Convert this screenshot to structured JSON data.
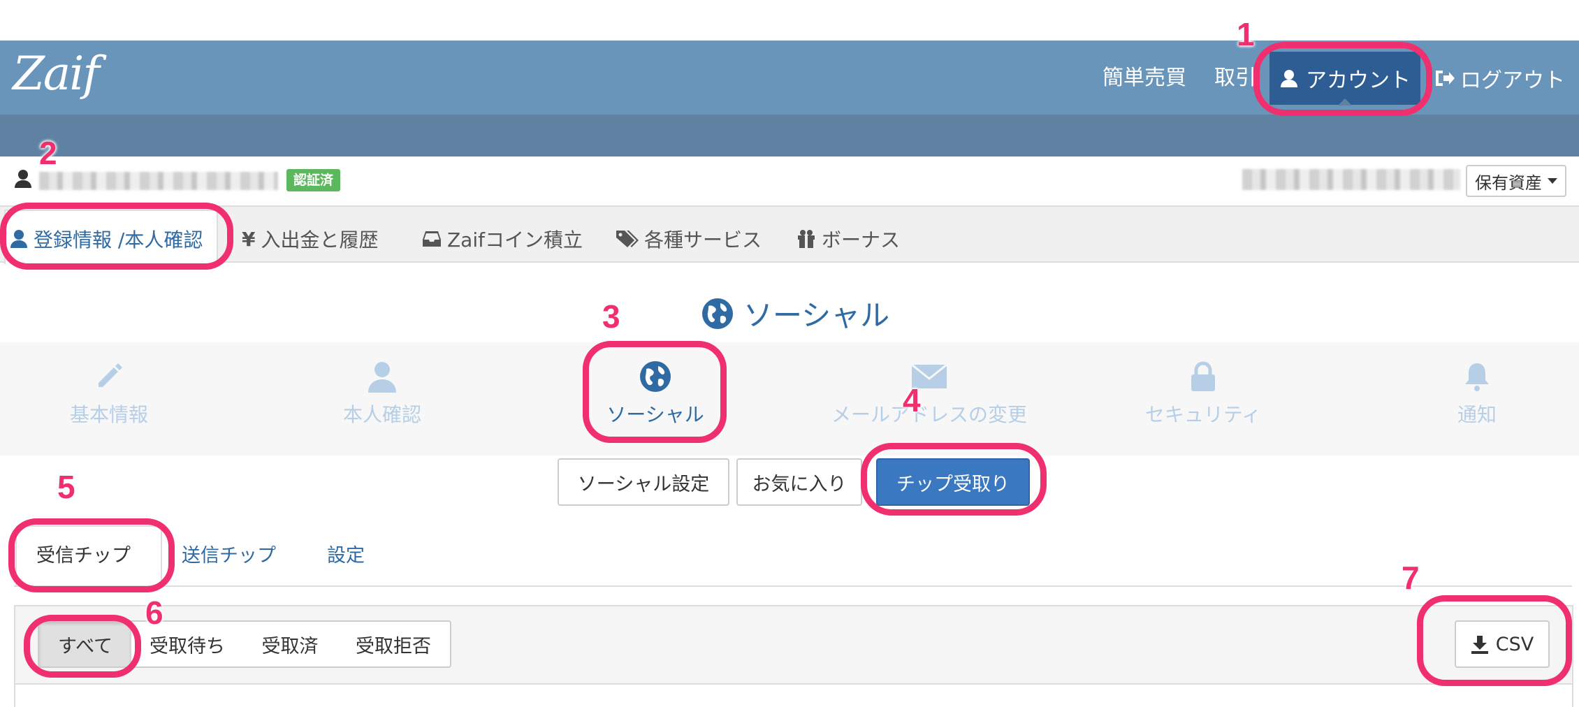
{
  "header": {
    "logo": "Zaif",
    "nav": {
      "simple_trade": "簡単売買",
      "trade": "取引",
      "account": "アカウント",
      "logout": "ログアウト"
    }
  },
  "userbar": {
    "verified_badge": "認証済",
    "assets_dropdown": "保有資産"
  },
  "main_tabs": [
    {
      "label": "登録情報 /本人確認",
      "icon": "user-icon",
      "active": true
    },
    {
      "label": "入出金と履歴",
      "icon": "yen-icon"
    },
    {
      "label": "Zaifコイン積立",
      "icon": "inbox-icon"
    },
    {
      "label": "各種サービス",
      "icon": "tags-icon"
    },
    {
      "label": "ボーナス",
      "icon": "gift-icon"
    }
  ],
  "section": {
    "title": "ソーシャル",
    "icon": "globe-icon"
  },
  "subnav": [
    {
      "label": "基本情報",
      "icon": "pencil-icon"
    },
    {
      "label": "本人確認",
      "icon": "user-icon"
    },
    {
      "label": "ソーシャル",
      "icon": "globe-icon",
      "active": true
    },
    {
      "label": "メールアドレスの変更",
      "icon": "envelope-icon"
    },
    {
      "label": "セキュリティ",
      "icon": "lock-icon"
    },
    {
      "label": "通知",
      "icon": "bell-icon"
    }
  ],
  "social_buttons": {
    "settings": "ソーシャル設定",
    "favorites": "お気に入り",
    "tip_receive": "チップ受取り"
  },
  "tip_tabs": {
    "received": "受信チップ",
    "sent": "送信チップ",
    "settings": "設定"
  },
  "filters": {
    "all": "すべて",
    "pending": "受取待ち",
    "received": "受取済",
    "rejected": "受取拒否"
  },
  "csv_button": "CSV",
  "annotations": [
    "1",
    "2",
    "3",
    "4",
    "5",
    "6",
    "7"
  ],
  "colors": {
    "header": "#6a95ba",
    "header_dark": "#5f82a3",
    "active_nav": "#2e5d93",
    "link": "#2f6aa3",
    "primary_button": "#3a78c2",
    "badge": "#5cb85c",
    "annotation": "#ef2f6e"
  }
}
